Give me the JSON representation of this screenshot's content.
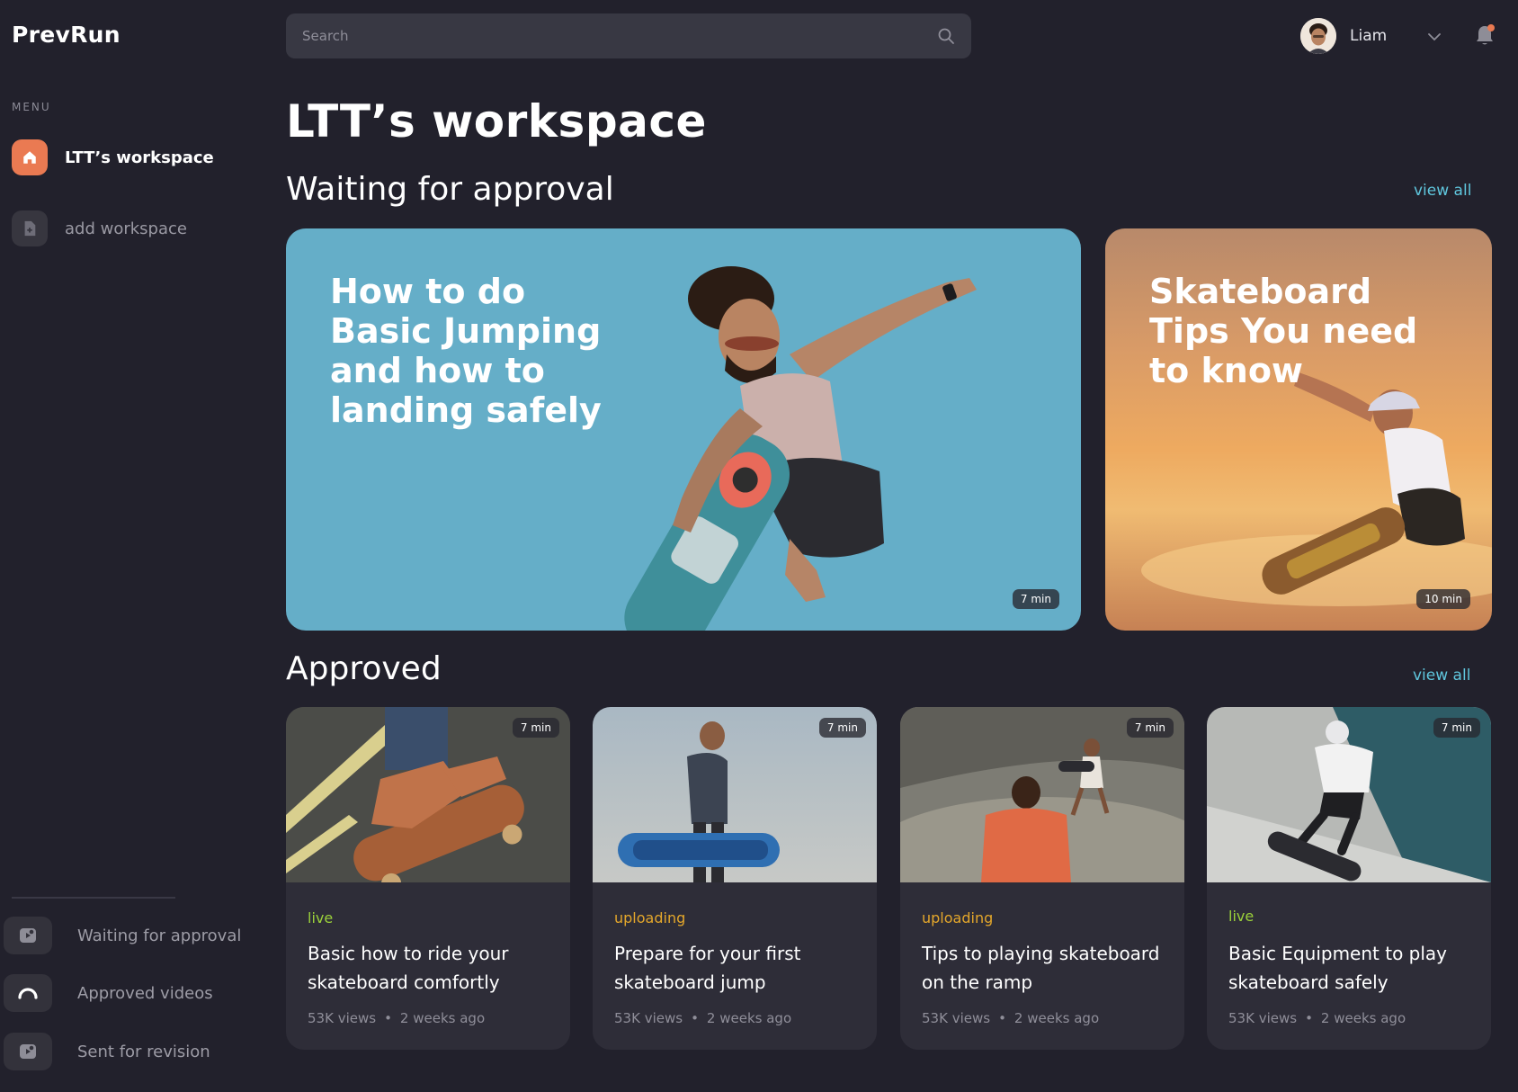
{
  "app": {
    "name": "PrevRun"
  },
  "sidebar": {
    "menu_caption": "MENU",
    "workspaces": [
      {
        "label": "LTT’s workspace",
        "icon": "home-icon",
        "active": true
      },
      {
        "label": "add workspace",
        "icon": "add-document-icon",
        "active": false
      }
    ],
    "bottom_items": [
      {
        "label": "Waiting for approval",
        "icon": "pending-video-icon"
      },
      {
        "label": "Approved videos",
        "icon": "approved-icon"
      },
      {
        "label": "Sent for revision",
        "icon": "revision-icon"
      }
    ]
  },
  "header": {
    "search_placeholder": "Search",
    "user_name": "Liam",
    "notification_color": "#ea7a52"
  },
  "main": {
    "page_title": "LTT’s workspace",
    "waiting": {
      "title": "Waiting for approval",
      "view_all": "view all",
      "videos": [
        {
          "title": "How to do\nBasic Jumping\nand how to\nlanding safely",
          "duration": "7 min"
        },
        {
          "title": "Skateboard\nTips You need\nto know",
          "duration": "10 min"
        }
      ]
    },
    "approved": {
      "title": "Approved",
      "view_all": "view all",
      "videos": [
        {
          "status": "live",
          "title": "Basic how to ride your skateboard comfortly",
          "views": "53K views",
          "age": "2 weeks ago",
          "duration": "7 min"
        },
        {
          "status": "uploading",
          "title": "Prepare for your first skateboard jump",
          "views": "53K views",
          "age": "2 weeks ago",
          "duration": "7 min"
        },
        {
          "status": "uploading",
          "title": "Tips to playing skateboard on the ramp",
          "views": "53K views",
          "age": "2 weeks ago",
          "duration": "7 min"
        },
        {
          "status": "live",
          "title": "Basic Equipment to play skateboard safely",
          "views": "53K views",
          "age": "2 weeks ago",
          "duration": "7 min"
        }
      ]
    }
  },
  "colors": {
    "background": "#22212c",
    "accent": "#ea7a52",
    "link": "#5fc6dd",
    "status_live": "#9bd13a",
    "status_uploading": "#e4a72b"
  }
}
